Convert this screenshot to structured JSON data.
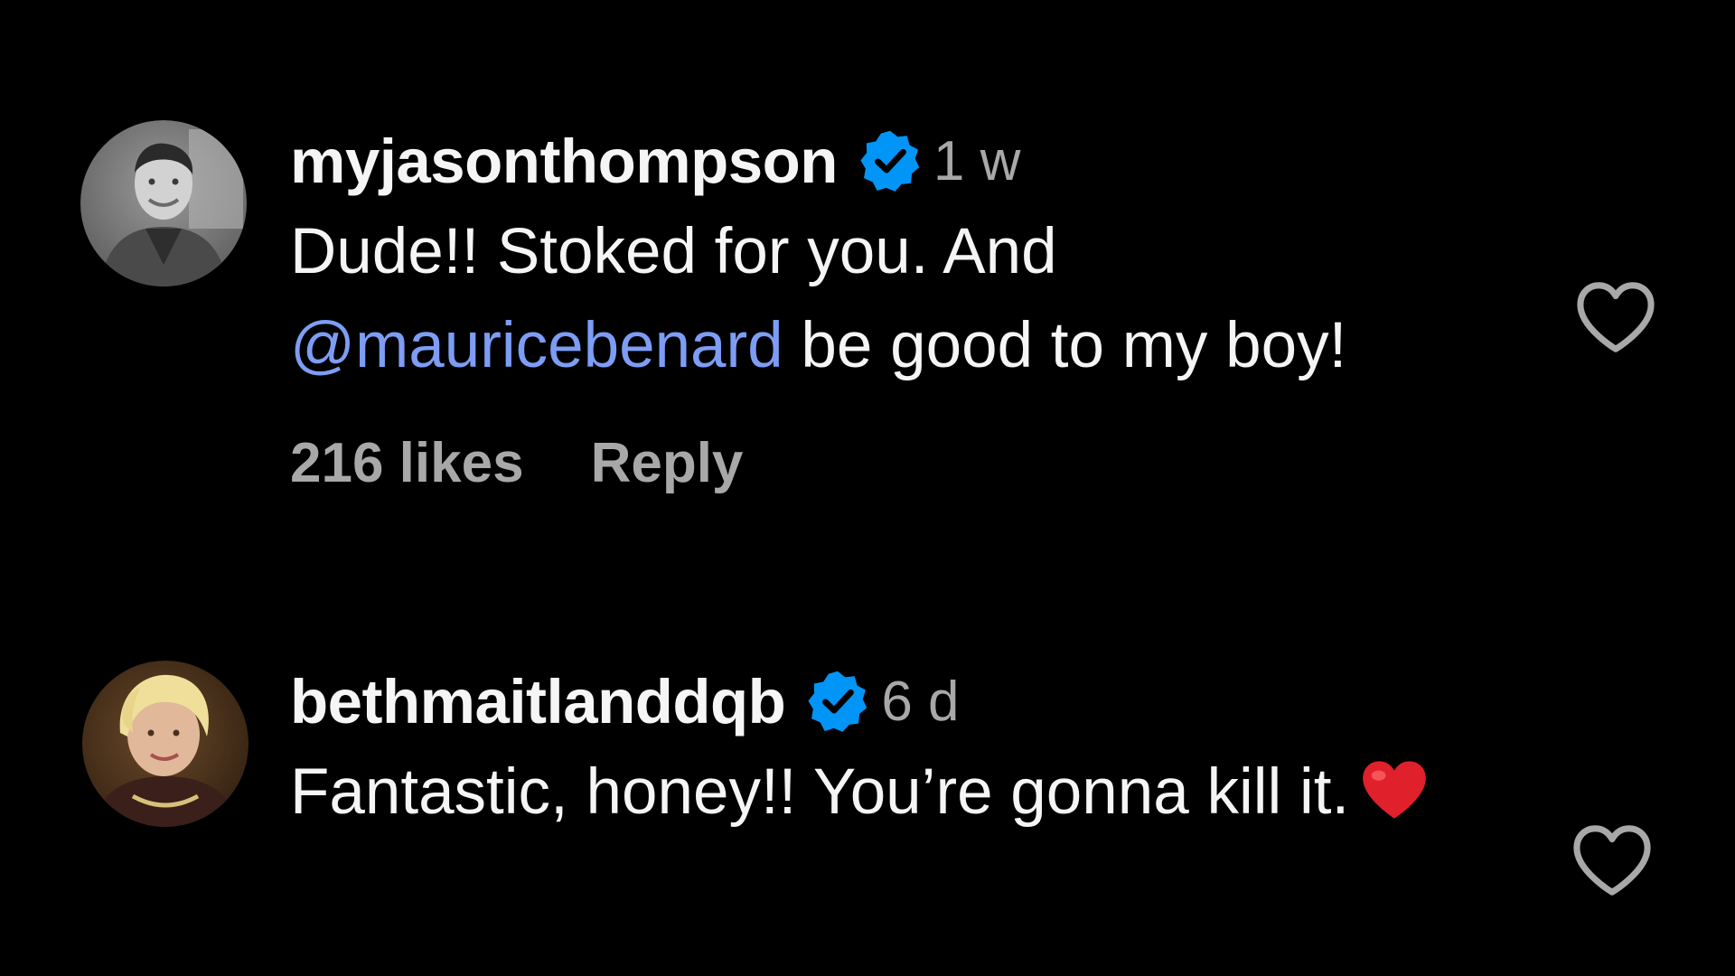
{
  "comments": [
    {
      "username": "myjasonthompson",
      "verified_icon": "verified-badge-icon",
      "time": "1 w",
      "text_before": "Dude!! Stoked for you. And",
      "mention": "@mauricebenard",
      "text_after": " be good to my boy!",
      "likes": "216 likes",
      "reply_label": "Reply",
      "like_icon": "heart-outline-icon"
    },
    {
      "username": "bethmaitlanddqb",
      "verified_icon": "verified-badge-icon",
      "time": "6 d",
      "text": "Fantastic, honey!! You’re gonna kill it.",
      "emoji": "red-heart-emoji",
      "like_icon": "heart-outline-icon"
    }
  ],
  "colors": {
    "background": "#000000",
    "text": "#f5f5f5",
    "secondary": "#a8a8a8",
    "mention": "#7d9df5",
    "verified": "#0095f6",
    "emoji_heart": "#e0202a"
  }
}
